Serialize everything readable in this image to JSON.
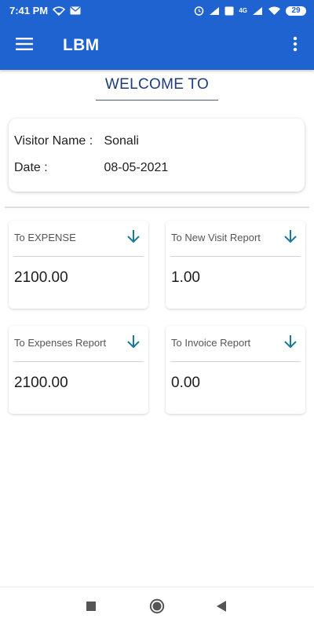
{
  "status_bar": {
    "time": "7:41 PM",
    "network": "4G",
    "battery": "29",
    "icons": [
      "wifi-icon",
      "mail-icon",
      "alarm-icon",
      "signal-icon",
      "volte-icon",
      "signal-icon",
      "wifi-icon",
      "battery-icon"
    ]
  },
  "app_bar": {
    "title": "LBM",
    "menu_icon": "hamburger-menu-icon",
    "more_icon": "more-vertical-icon"
  },
  "welcome": {
    "title": "WELCOME TO"
  },
  "visitor": {
    "name_label": "Visitor Name :",
    "name_value": "Sonali",
    "date_label": "Date :",
    "date_value": "08-05-2021"
  },
  "cards": [
    {
      "title": "To EXPENSE",
      "value": "2100.00",
      "icon": "arrow-down-icon"
    },
    {
      "title": "To New Visit Report",
      "value": "1.00",
      "icon": "arrow-down-icon"
    },
    {
      "title": "To Expenses Report",
      "value": "2100.00",
      "icon": "arrow-down-icon"
    },
    {
      "title": "To Invoice Report",
      "value": "0.00",
      "icon": "arrow-down-icon"
    }
  ],
  "colors": {
    "primary": "#1e63cf",
    "welcome_text": "#1c3d7a",
    "arrow": "#1a7a9c"
  },
  "nav_bar": {
    "buttons": [
      "recents-square-icon",
      "home-circle-icon",
      "back-triangle-icon"
    ]
  }
}
